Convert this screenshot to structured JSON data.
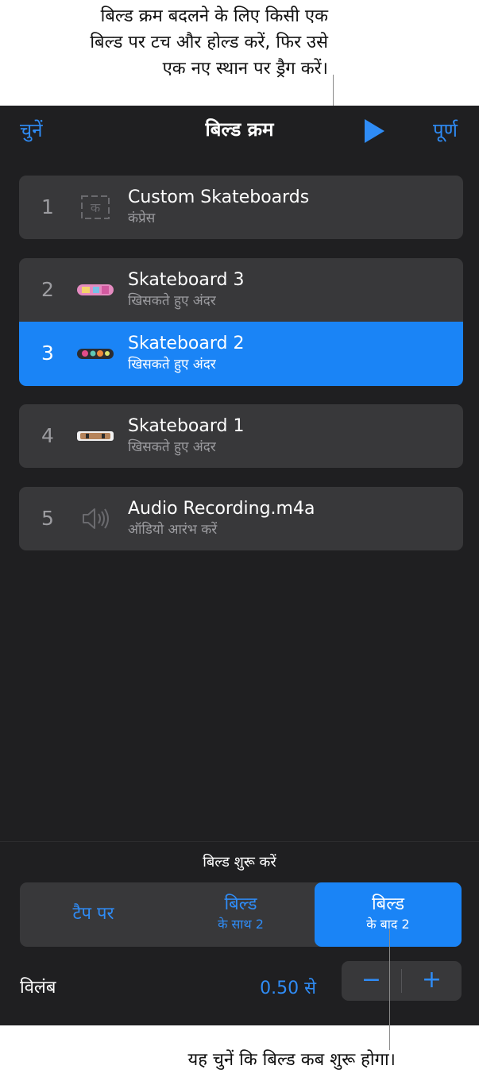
{
  "callouts": {
    "top_line1": "बिल्ड क्रम बदलने के लिए किसी एक",
    "top_line2": "बिल्ड पर टच और होल्ड करें, फिर उसे",
    "top_line3": "एक नए स्थान पर ड्रैग करें।",
    "bottom": "यह चुनें कि बिल्ड कब शुरू होगा।"
  },
  "nav": {
    "select_label": "चुनें",
    "title": "बिल्ड क्रम",
    "done_label": "पूर्ण",
    "play_icon": "play-icon"
  },
  "builds": [
    {
      "num": "1",
      "title": "Custom Skateboards",
      "effect": "कंप्रेस",
      "thumb": "text-box-icon"
    },
    {
      "num": "2",
      "title": "Skateboard 3",
      "effect": "खिसकते हुए अंदर",
      "thumb": "skateboard-pink-thumbnail"
    },
    {
      "num": "3",
      "title": "Skateboard 2",
      "effect": "खिसकते हुए अंदर",
      "thumb": "skateboard-floral-thumbnail"
    },
    {
      "num": "4",
      "title": "Skateboard 1",
      "effect": "खिसकते हुए अंदर",
      "thumb": "skateboard-wood-thumbnail"
    },
    {
      "num": "5",
      "title": "Audio Recording.m4a",
      "effect": "ऑडियो आरंभ करें",
      "thumb": "speaker-icon"
    }
  ],
  "start": {
    "label": "बिल्ड शुरू करें",
    "options": [
      {
        "line1": "टैप पर",
        "line2": ""
      },
      {
        "line1": "बिल्ड",
        "line2": "के साथ 2"
      },
      {
        "line1": "बिल्ड",
        "line2": "के बाद 2"
      }
    ],
    "selected_index": 2
  },
  "delay": {
    "label": "विलंब",
    "value": "0.50 से",
    "minus": "−",
    "plus": "+"
  },
  "colors": {
    "accent": "#2f8cf6",
    "selected_row": "#1a84f6",
    "panel_bg": "#1f1f21",
    "row_bg": "#38383a"
  }
}
